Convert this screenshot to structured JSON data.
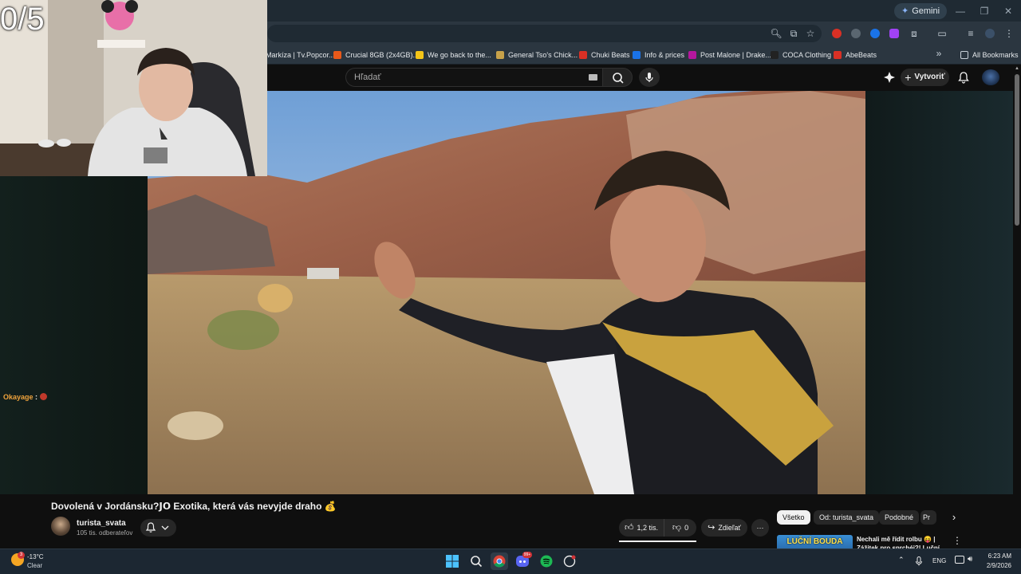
{
  "overlay": {
    "counter": "0/5",
    "chat_user": "Okayage",
    "chat_separator": ":"
  },
  "browser": {
    "gemini_label": "Gemini",
    "bookmarks": [
      {
        "label": "Markíza | Tv.Popcor...",
        "icon": "site-icon",
        "color": "#2d6cdf"
      },
      {
        "label": "Crucial 8GB (2x4GB)...",
        "icon": "crucial-icon",
        "color": "#e8591a"
      },
      {
        "label": "We go back to the...",
        "icon": "g-icon",
        "color": "#f5c518"
      },
      {
        "label": "General Tso's Chick...",
        "icon": "recipe-icon",
        "color": "#c8a24a"
      },
      {
        "label": "Chuki Beats",
        "icon": "beats-icon",
        "color": "#d93025"
      },
      {
        "label": "Info & prices",
        "icon": "b-icon",
        "color": "#1a73e8"
      },
      {
        "label": "Post Malone | Drake...",
        "icon": "music-icon",
        "color": "#b5179e"
      },
      {
        "label": "COCA Clothing",
        "icon": "clothing-icon",
        "color": "#222222"
      },
      {
        "label": "AbeBeats",
        "icon": "abebeats-icon",
        "color": "#d93025"
      }
    ],
    "all_bookmarks": "All Bookmarks"
  },
  "youtube": {
    "search_placeholder": "Hľadať",
    "create_label": "Vytvoriť",
    "video": {
      "title": "Dovolená v Jordánsku?𝗝𝗢 Exotika, která vás nevyjde draho 💰",
      "channel": "turista_svata",
      "subscribers": "105 tis. odberateľov",
      "likes": "1,2 tis.",
      "dislikes": "0",
      "share_label": "Zdieľať"
    },
    "chips": [
      "Všetko",
      "Od: turista_svata",
      "Podobné",
      "Pr"
    ],
    "recommendation": {
      "thumb_text": "LUČNÍ BOUDA",
      "title": "Nechali mě řídit rolbu 😝 | Zážitek pro sprchéj?! Luční bouda"
    }
  },
  "taskbar": {
    "temperature": "-13°C",
    "condition": "Clear",
    "weather_badge": "3",
    "language": "ENG",
    "time": "6:23 AM",
    "date": "2/9/2026",
    "discord_badge": "99+"
  }
}
